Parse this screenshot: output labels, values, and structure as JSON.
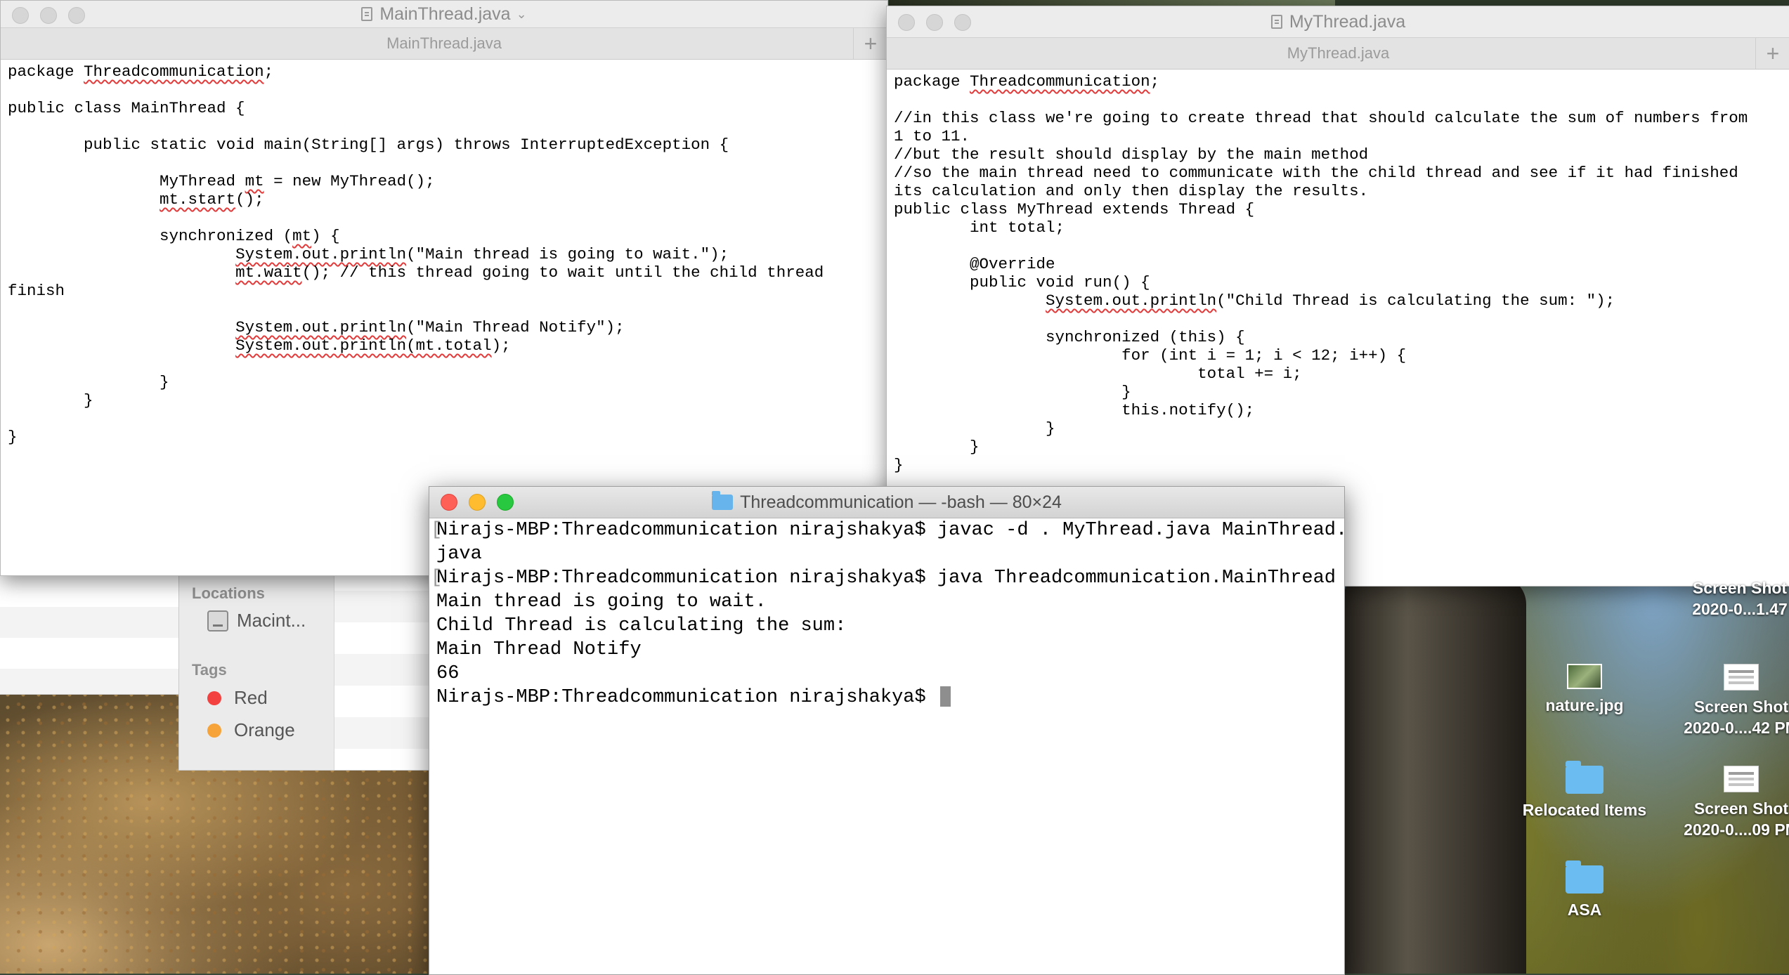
{
  "main_window": {
    "title": "MainThread.java",
    "tab": "MainThread.java",
    "new_tab_symbol": "+",
    "code": [
      [
        [
          "package ",
          ""
        ],
        [
          "Threadcommunication",
          "sq"
        ],
        [
          ";",
          ""
        ]
      ],
      [
        [
          "",
          ""
        ]
      ],
      [
        [
          "public class MainThread {",
          ""
        ]
      ],
      [
        [
          "",
          ""
        ]
      ],
      [
        [
          "\tpublic static void main(String[] args) throws InterruptedException {",
          ""
        ]
      ],
      [
        [
          "",
          ""
        ]
      ],
      [
        [
          "\t\tMyThread ",
          ""
        ],
        [
          "mt",
          "sq"
        ],
        [
          " = new MyThread();",
          ""
        ]
      ],
      [
        [
          "\t\t",
          ""
        ],
        [
          "mt.start",
          "sq"
        ],
        [
          "();",
          ""
        ]
      ],
      [
        [
          "",
          ""
        ]
      ],
      [
        [
          "\t\tsynchronized (",
          ""
        ],
        [
          "mt",
          "sq"
        ],
        [
          ") {",
          ""
        ]
      ],
      [
        [
          "\t\t\t",
          ""
        ],
        [
          "System.out.println",
          "sq"
        ],
        [
          "(\"Main thread is going to wait.\");",
          ""
        ]
      ],
      [
        [
          "\t\t\t",
          ""
        ],
        [
          "mt.wait",
          "sq"
        ],
        [
          "(); // this thread going to wait until the child thread",
          ""
        ]
      ],
      [
        [
          "finish",
          ""
        ]
      ],
      [
        [
          "",
          ""
        ]
      ],
      [
        [
          "\t\t\t",
          ""
        ],
        [
          "System.out.println",
          "sq"
        ],
        [
          "(\"Main Thread Notify\");",
          ""
        ]
      ],
      [
        [
          "\t\t\t",
          ""
        ],
        [
          "System.out.println(mt.total",
          "sq"
        ],
        [
          ");",
          ""
        ]
      ],
      [
        [
          "",
          ""
        ]
      ],
      [
        [
          "\t\t}",
          ""
        ]
      ],
      [
        [
          "\t}",
          ""
        ]
      ],
      [
        [
          "",
          ""
        ]
      ],
      [
        [
          "}",
          ""
        ]
      ]
    ]
  },
  "my_window": {
    "title": "MyThread.java",
    "tab": "MyThread.java",
    "new_tab_symbol": "+",
    "code": [
      [
        [
          "package ",
          ""
        ],
        [
          "Threadcommunication",
          "sq"
        ],
        [
          ";",
          ""
        ]
      ],
      [
        [
          "",
          ""
        ]
      ],
      [
        [
          "//in this class we're going to create thread that should calculate the sum of numbers from",
          ""
        ]
      ],
      [
        [
          "1 to 11.",
          ""
        ]
      ],
      [
        [
          "//but the result should display by the main method",
          ""
        ]
      ],
      [
        [
          "//so the main thread need to communicate with the child thread and see if it had finished",
          ""
        ]
      ],
      [
        [
          "its calculation and only then display the results.",
          ""
        ]
      ],
      [
        [
          "public class MyThread extends Thread {",
          ""
        ]
      ],
      [
        [
          "\tint total;",
          ""
        ]
      ],
      [
        [
          "",
          ""
        ]
      ],
      [
        [
          "\t@Override",
          ""
        ]
      ],
      [
        [
          "\tpublic void run() {",
          ""
        ]
      ],
      [
        [
          "\t\t",
          ""
        ],
        [
          "System.out.println",
          "sq"
        ],
        [
          "(\"Child Thread is calculating the sum: \");",
          ""
        ]
      ],
      [
        [
          "",
          ""
        ]
      ],
      [
        [
          "\t\tsynchronized (this) {",
          ""
        ]
      ],
      [
        [
          "\t\t\tfor (int i = 1; i < 12; i++) {",
          ""
        ]
      ],
      [
        [
          "\t\t\t\ttotal += i;",
          ""
        ]
      ],
      [
        [
          "\t\t\t}",
          ""
        ]
      ],
      [
        [
          "\t\t\tthis.notify();",
          ""
        ]
      ],
      [
        [
          "\t\t}",
          ""
        ]
      ],
      [
        [
          "\t}",
          ""
        ]
      ],
      [
        [
          "}",
          ""
        ]
      ]
    ]
  },
  "terminal": {
    "title": "Threadcommunication — -bash — 80×24",
    "lines": [
      {
        "text": "Nirajs-MBP:Threadcommunication nirajshakya$ javac -d . MyThread.java MainThread.",
        "mark": true,
        "rmark": true
      },
      {
        "text": "java",
        "mark": false,
        "rmark": false
      },
      {
        "text": "Nirajs-MBP:Threadcommunication nirajshakya$ java Threadcommunication.MainThread ",
        "mark": true,
        "rmark": true
      },
      {
        "text": "Main thread is going to wait.",
        "mark": false,
        "rmark": false
      },
      {
        "text": "Child Thread is calculating the sum:",
        "mark": false,
        "rmark": false
      },
      {
        "text": "Main Thread Notify",
        "mark": false,
        "rmark": false
      },
      {
        "text": "66",
        "mark": false,
        "rmark": false
      }
    ],
    "prompt": "Nirajs-MBP:Threadcommunication nirajshakya$ "
  },
  "finder": {
    "locations_header": "Locations",
    "disk_label": "Macint...",
    "tags_header": "Tags",
    "tags": [
      {
        "label": "Red",
        "color": "#f2413e"
      },
      {
        "label": "Orange",
        "color": "#f6a33a"
      }
    ]
  },
  "desktop": {
    "icons": [
      {
        "id": "screenshot-1",
        "kind": "screenshot-icon",
        "line1": "Screen Shot",
        "line2": "2020-0...1.47"
      },
      {
        "id": "nature",
        "kind": "photo-icon",
        "line1": "nature.jpg",
        "line2": ""
      },
      {
        "id": "screenshot-2",
        "kind": "screenshot-icon",
        "line1": "Screen Shot",
        "line2": "2020-0....42 PM"
      },
      {
        "id": "relocated",
        "kind": "folder-icon",
        "line1": "Relocated Items",
        "line2": ""
      },
      {
        "id": "screenshot-3",
        "kind": "screenshot-icon",
        "line1": "Screen Shot",
        "line2": "2020-0....09 PM"
      },
      {
        "id": "asa",
        "kind": "folder-icon",
        "line1": "ASA",
        "line2": ""
      }
    ]
  }
}
